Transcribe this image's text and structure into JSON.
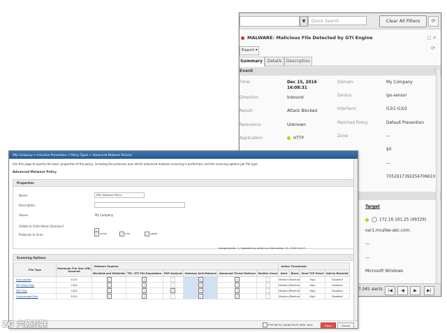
{
  "back": {
    "search_placeholder": "Quick Search",
    "clear_label": "Clear All Filters",
    "title": "MALWARE: Malicious File Detected by GTI Engine",
    "title_controls": "□ ✕",
    "export_label": "Export ▾",
    "tabs": [
      "Summary",
      "Details",
      "Description"
    ],
    "section_event": "Event",
    "left_fields": [
      {
        "label": "Time:",
        "value": "Dec 15, 2016\n16:08:31"
      },
      {
        "label": "Direction:",
        "value": "Inbound"
      },
      {
        "label": "Result:",
        "value": "Attack Blocked"
      },
      {
        "label": "Relevance:",
        "value": "Unknown"
      },
      {
        "label": "Application:",
        "value": "HTTP"
      }
    ],
    "right_fields": [
      {
        "label": "Domain:",
        "value": "My Company"
      },
      {
        "label": "Device:",
        "value": "ips-sensor"
      },
      {
        "label": "Interface:",
        "value": "G3/1-G3/2"
      },
      {
        "label": "Matched Policy:",
        "value": "Default Prevention"
      },
      {
        "label": "Zone:",
        "value": "---"
      },
      {
        "label": "",
        "value": "$0"
      },
      {
        "label": "",
        "value": "---"
      },
      {
        "label": "",
        "value": "7052917392254706610"
      }
    ],
    "target_heading": "Target",
    "target_ip": "172.16.161.25 (49329)",
    "target_host": "oar1.mcafee-abc.com.",
    "target_dash1": "---",
    "target_dash2": "---",
    "target_os": "Microsoft Windows",
    "alerts_text": "7,045 alerts",
    "pager": [
      "|◀",
      "◀",
      "▶",
      "▶|"
    ]
  },
  "front": {
    "breadcrumb": "/My Company > Intrusion Prevention > Policy Types > Advanced Malware Policies",
    "description": "Use this page to specify the basic properties of the policy, including the protocols over which advanced malware scanning is performed, and the scanning options per file type.",
    "page_title": "Advanced Malware Policy",
    "properties_heading": "Properties",
    "labels": {
      "name": "Name:",
      "description": "Description:",
      "owner": "Owner:",
      "visible": "Visible to Child Admin Domains?",
      "protocols": "Protocols to Scan:"
    },
    "name_value": "EBC Malware Policy",
    "owner_value": "My Company",
    "protocols": [
      "HTTP",
      "FTP",
      "SMTP"
    ],
    "assignments": "Assignments: 1; Updated by admin on December 15, 2016 14:07",
    "scanning_heading": "Scanning Options",
    "col_file_type": "File Type",
    "col_max_size": "Maximum File Size (KB) Scanned",
    "group_engines": "Malware Engines",
    "group_thresholds": "Action Thresholds",
    "engine_cols": [
      "Blacklist and Whitelist",
      "TIE / GTI File Reputation",
      "PDF Analysis",
      "Gateway Anti-Malware",
      "Advanced Threat Defense",
      "McAfee Cloud"
    ],
    "threshold_cols": [
      "Alert",
      "Block",
      "Send TCP Reset",
      "Add to Blacklist"
    ],
    "rows": [
      {
        "type": "Executables",
        "size": "5120",
        "engines": [
          "✓",
          "✓",
          "",
          "✓",
          "✓",
          ""
        ],
        "alert": "Medium",
        "block": "Medium",
        "reset": "High",
        "blacklist": "Disabled"
      },
      {
        "type": "MS Office Files",
        "size": "1024",
        "engines": [
          "✓",
          "✓",
          "",
          "✓",
          "✓",
          ""
        ],
        "alert": "Medium",
        "block": "Medium",
        "reset": "High",
        "blacklist": "Disabled"
      },
      {
        "type": "PDF Files",
        "size": "1024",
        "engines": [
          "✓",
          "✓",
          "✓",
          "✓",
          "✓",
          ""
        ],
        "alert": "Medium",
        "block": "Medium",
        "reset": "High",
        "blacklist": "Disabled"
      },
      {
        "type": "Compressed Files",
        "size": "5120",
        "engines": [
          "✓",
          "✓",
          "",
          "✓",
          "✓",
          ""
        ],
        "alert": "Medium",
        "block": "Medium",
        "reset": "High",
        "blacklist": "Disabled"
      }
    ],
    "prompt_label": "Prompt for assignment after save",
    "save_label": "Save",
    "cancel_label": "Cancel"
  },
  "watermark": "ZG 六顾互联"
}
